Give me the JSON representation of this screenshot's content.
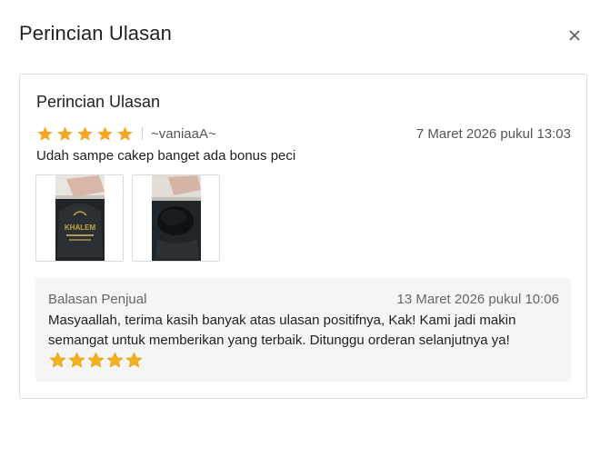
{
  "modal": {
    "title": "Perincian Ulasan",
    "close_label": "×"
  },
  "review": {
    "title": "Perincian Ulasan",
    "rating": 5,
    "rating_max": 5,
    "star_color": "#f6a623",
    "username": "~vaniaaA~",
    "date": "7 Maret 2026 pukul 13:03",
    "comment": "Udah sampe cakep banget ada bonus peci",
    "photos": [
      {
        "label": "KHALEM"
      },
      {
        "label": ""
      }
    ]
  },
  "seller_reply": {
    "label": "Balasan Penjual",
    "date": "13 Maret 2026 pukul 10:06",
    "text": "Masyaallah, terima kasih banyak atas ulasan positifnya, Kak! Kami jadi makin semangat untuk memberikan yang terbaik. Ditunggu orderan selanjutnya ya!",
    "emoji_stars": 5,
    "emoji_star_color": "#f5b21a"
  }
}
